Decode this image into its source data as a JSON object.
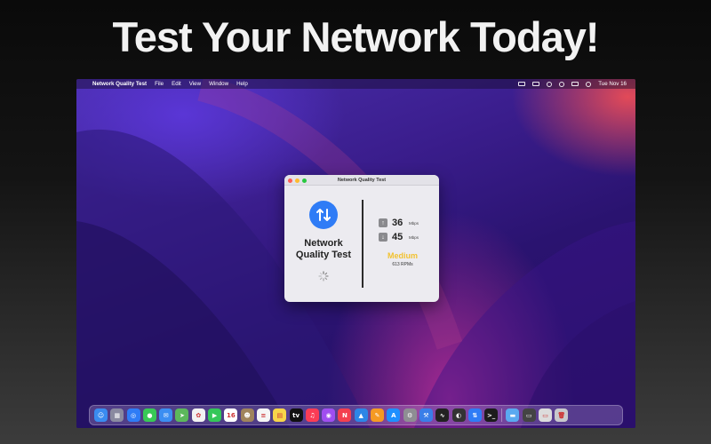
{
  "headline": "Test Your Network Today!",
  "menubar": {
    "apple_glyph": "",
    "app_name": "Network Quality Test",
    "menus": [
      "File",
      "Edit",
      "View",
      "Window",
      "Help"
    ],
    "clock": "Tue Nov 16",
    "status_icons": [
      "display-icon",
      "battery-icon",
      "wifi-icon",
      "search-icon",
      "control-center-icon",
      "siri-icon"
    ]
  },
  "window": {
    "title": "Network Quality Test",
    "app_name_line1": "Network",
    "app_name_line2": "Quality Test",
    "download": {
      "value": "36",
      "unit": "Mbps"
    },
    "upload": {
      "value": "45",
      "unit": "Mbps"
    },
    "quality": "Medium",
    "rpm": "613 RPMs"
  },
  "dock": {
    "calendar_day": "16",
    "apps": [
      {
        "name": "finder",
        "color": "#3a8cf0",
        "glyph": "☺"
      },
      {
        "name": "launchpad",
        "color": "#8a8aa0",
        "glyph": "▦"
      },
      {
        "name": "safari",
        "color": "#2f7cf6",
        "glyph": "◎"
      },
      {
        "name": "messages",
        "color": "#38c956",
        "glyph": "●"
      },
      {
        "name": "mail",
        "color": "#3b8ef2",
        "glyph": "✉"
      },
      {
        "name": "maps",
        "color": "#5cb85c",
        "glyph": "➤"
      },
      {
        "name": "photos",
        "color": "#f2f2f2",
        "glyph": "✿"
      },
      {
        "name": "facetime",
        "color": "#34c759",
        "glyph": "▶"
      },
      {
        "name": "calendar",
        "color": "#ffffff",
        "glyph": "16"
      },
      {
        "name": "contacts",
        "color": "#a0845c",
        "glyph": "☻"
      },
      {
        "name": "reminders",
        "color": "#f5f5f5",
        "glyph": "≡"
      },
      {
        "name": "notes",
        "color": "#f7d54a",
        "glyph": "▤"
      },
      {
        "name": "tv",
        "color": "#111111",
        "glyph": "tv"
      },
      {
        "name": "music",
        "color": "#fa3c55",
        "glyph": "♫"
      },
      {
        "name": "podcasts",
        "color": "#a04ef0",
        "glyph": "◉"
      },
      {
        "name": "news",
        "color": "#f43f4f",
        "glyph": "N"
      },
      {
        "name": "keynote",
        "color": "#2d86e6",
        "glyph": "▲"
      },
      {
        "name": "pages",
        "color": "#f59a23",
        "glyph": "✎"
      },
      {
        "name": "app-store",
        "color": "#1e90ff",
        "glyph": "A"
      },
      {
        "name": "system-preferences",
        "color": "#8e8e93",
        "glyph": "⚙"
      },
      {
        "name": "xcode",
        "color": "#3a7ee8",
        "glyph": "⚒"
      },
      {
        "name": "activity-monitor",
        "color": "#222222",
        "glyph": "∿"
      },
      {
        "name": "github",
        "color": "#333333",
        "glyph": "◐"
      },
      {
        "name": "network-quality",
        "color": "#2f7cf6",
        "glyph": "⇅"
      },
      {
        "name": "terminal",
        "color": "#1c1c1c",
        "glyph": ">_"
      },
      {
        "name": "downloads-folder",
        "color": "#5aa9f0",
        "glyph": "▬"
      },
      {
        "name": "recent-window",
        "color": "#444444",
        "glyph": "▭"
      },
      {
        "name": "preview-stack",
        "color": "#dcdcdc",
        "glyph": "▭"
      },
      {
        "name": "trash",
        "color": "#c8c8cc",
        "glyph": "🗑"
      }
    ]
  }
}
